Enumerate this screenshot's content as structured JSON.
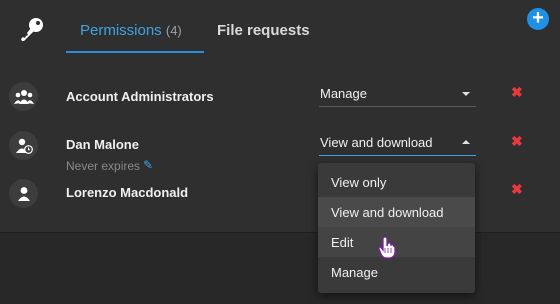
{
  "tabs": {
    "permissions_label": "Permissions",
    "permissions_count": "(4)",
    "file_requests_label": "File requests"
  },
  "header": {
    "add_symbol": "+"
  },
  "rows": [
    {
      "name": "Account Administrators",
      "permission": "Manage"
    },
    {
      "name": "Dan Malone",
      "permission": "View and download",
      "expiry": "Never expires"
    },
    {
      "name": "Lorenzo Macdonald"
    }
  ],
  "menu": {
    "options": [
      "View only",
      "View and download",
      "Edit",
      "Manage"
    ],
    "selected": "View and download",
    "hovered": "Edit"
  },
  "remove_symbol": "✖",
  "colors": {
    "accent": "#3fa3e3",
    "danger": "#e83a3a",
    "add": "#1e90e6"
  },
  "icons": [
    "key-icon",
    "add-icon",
    "group-icon",
    "user-clock-icon",
    "user-icon",
    "pencil-icon",
    "remove-icon",
    "hand-cursor-icon"
  ]
}
